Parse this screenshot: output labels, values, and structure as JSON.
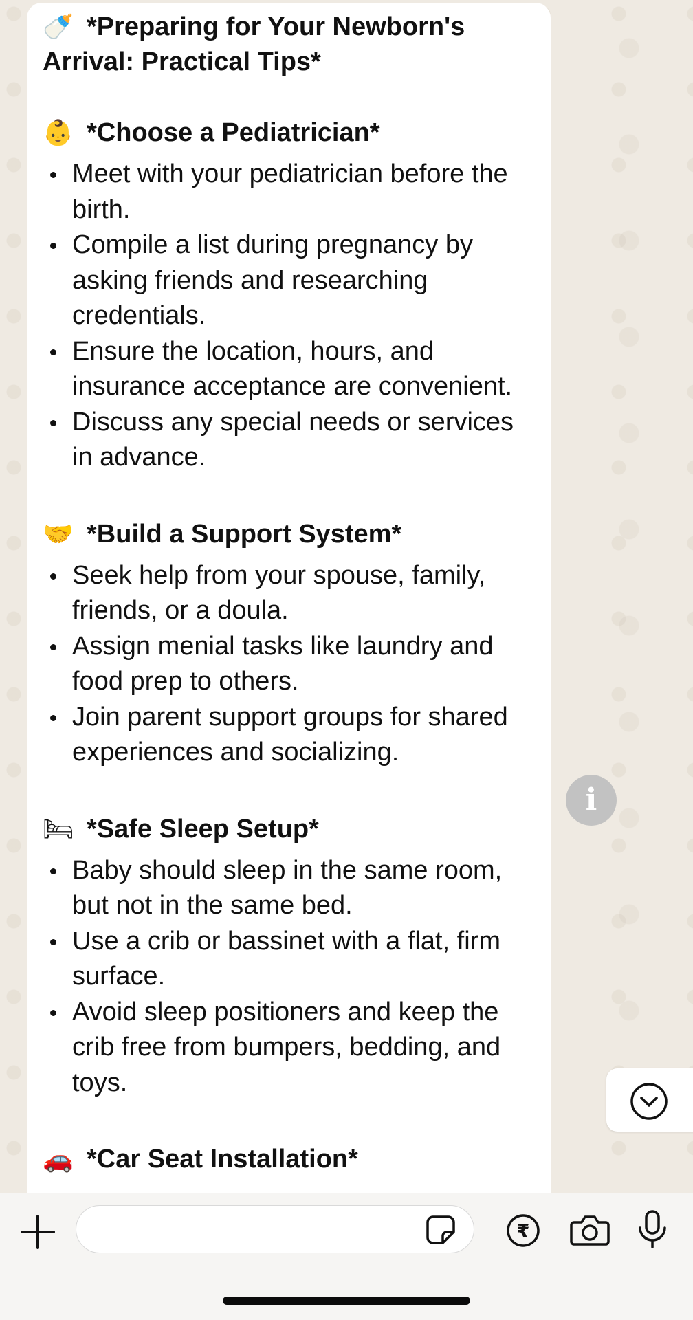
{
  "message": {
    "title_emoji": "🍼",
    "title_text": "*Preparing for Your Newborn's Arrival: Practical Tips*",
    "sections": [
      {
        "emoji": "👶",
        "heading": "*Choose a Pediatrician*",
        "bullets": [
          "Meet with your pediatrician before the birth.",
          "Compile a list during pregnancy by asking friends and researching credentials.",
          "Ensure the location, hours, and insurance acceptance are convenient.",
          "Discuss any special needs or services in advance."
        ]
      },
      {
        "emoji": "🤝",
        "heading": "*Build a Support System*",
        "bullets": [
          "Seek help from your spouse, family, friends, or a doula.",
          "Assign menial tasks like laundry and food prep to others.",
          "Join parent support groups for shared experiences and socializing."
        ]
      },
      {
        "emoji": "🛏",
        "heading": "*Safe Sleep Setup*",
        "bullets": [
          "Baby should sleep in the same room, but not in the same bed.",
          "Use a crib or bassinet with a flat, firm surface.",
          "Avoid sleep positioners and keep the crib free from bumpers, bedding, and toys."
        ]
      },
      {
        "emoji": "🚗",
        "heading": "*Car Seat Installation*",
        "bullets": []
      }
    ]
  },
  "floating": {
    "info_label": "i",
    "scroll_down_icon": "chevron-down-circle-icon"
  },
  "composer": {
    "input_value": "",
    "input_placeholder": "",
    "icons": [
      "plus-icon",
      "sticker-icon",
      "rupee-payment-icon",
      "camera-icon",
      "microphone-icon"
    ]
  },
  "colors": {
    "wallpaper": "#efeae2",
    "bubble": "#ffffff",
    "composer_bg": "#f6f5f3",
    "info_button": "#c2c2c2",
    "text": "#111111"
  }
}
